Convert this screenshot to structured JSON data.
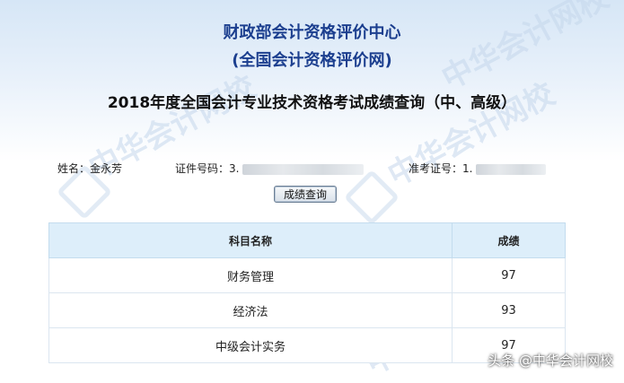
{
  "header": {
    "org_name": "财政部会计资格评价中心",
    "org_site": "(全国会计资格评价网)",
    "page_title": "2018年度全国会计专业技术资格考试成绩查询（中、高级）"
  },
  "candidate": {
    "name_label": "姓名：",
    "name_value": "金永芳",
    "id_label": "证件号码：",
    "id_visible_prefix": "3.",
    "ticket_label": "准考证号：",
    "ticket_visible_prefix": "1."
  },
  "query_button": "成绩查询",
  "table": {
    "headers": [
      "科目名称",
      "成绩"
    ],
    "rows": [
      {
        "subject": "财务管理",
        "score": "97"
      },
      {
        "subject": "经济法",
        "score": "93"
      },
      {
        "subject": "中级会计实务",
        "score": "97"
      }
    ]
  },
  "watermark": {
    "text": "中华会计网校",
    "footer": "头条 @中华会计网校"
  },
  "colors": {
    "title_blue": "#1c3f8f",
    "header_bg": "#ddeefa"
  }
}
